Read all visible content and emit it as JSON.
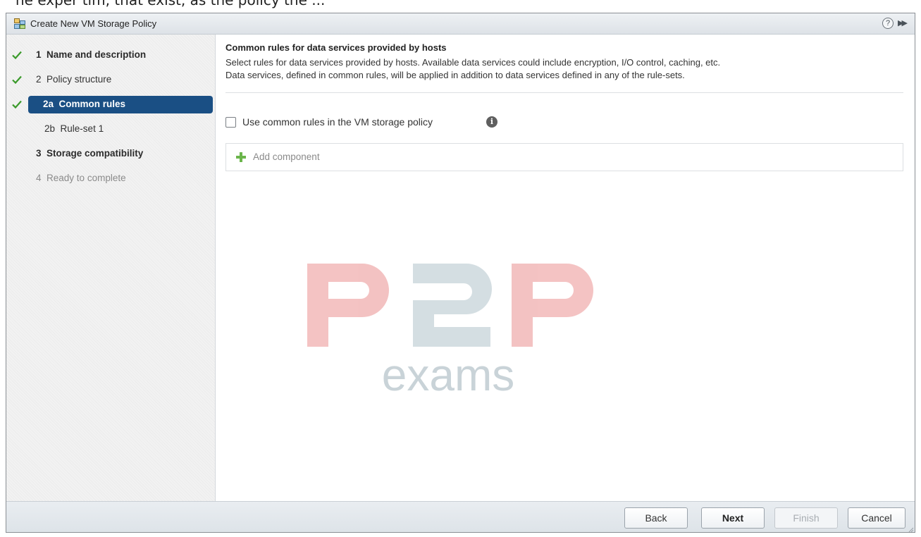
{
  "caption": {
    "text": "he exper tim, that exist, as the policy the ..."
  },
  "window": {
    "title": "Create New VM Storage Policy",
    "help_glyph": "?",
    "expand_glyph": "▶▶"
  },
  "steps": [
    {
      "number": "1",
      "label": "Name and description",
      "state": "completed"
    },
    {
      "number": "2",
      "label": "Policy structure",
      "state": "completed"
    },
    {
      "number": "2a",
      "label": "Common rules",
      "state": "current"
    },
    {
      "number": "2b",
      "label": "Rule-set 1",
      "state": "pending"
    },
    {
      "number": "3",
      "label": "Storage compatibility",
      "state": "pending"
    },
    {
      "number": "4",
      "label": "Ready to complete",
      "state": "disabled"
    }
  ],
  "content": {
    "section_title": "Common rules for data services provided by hosts",
    "description_line1": "Select rules for data services provided by hosts. Available data services could include encryption, I/O control, caching, etc.",
    "description_line2": "Data services, defined in common rules, will be applied in addition to data services defined in any of the rule-sets.",
    "checkbox_label": "Use common rules in the VM storage policy",
    "checkbox_checked": false,
    "info_glyph": "i",
    "add_component_label": "Add component"
  },
  "watermark": {
    "brand": "P2P",
    "sub": "exams",
    "colors": {
      "primary": "#f2b8b8",
      "secondary": "#cdd9de",
      "accent": "#f5a7a7"
    }
  },
  "footer": {
    "back_label": "Back",
    "next_label": "Next",
    "finish_label": "Finish",
    "cancel_label": "Cancel"
  },
  "colors": {
    "accent": "#1a4f84",
    "check": "#3a9a2a",
    "add_plus": "#6bb54b"
  }
}
